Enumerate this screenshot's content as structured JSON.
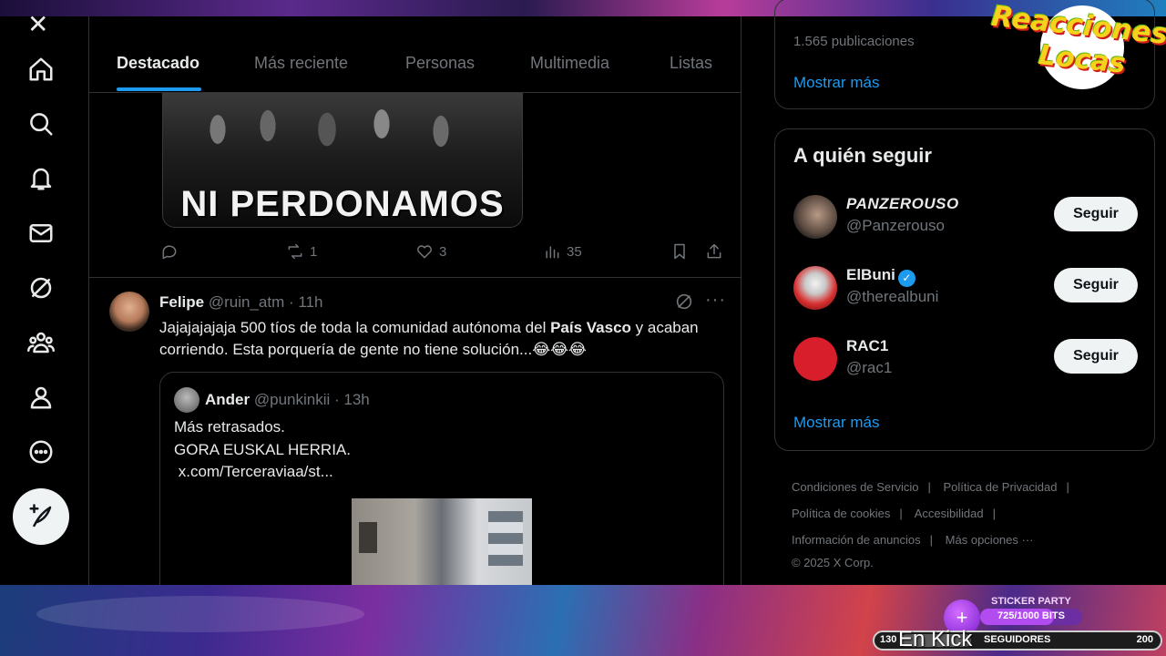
{
  "tabs": [
    "Destacado",
    "Más reciente",
    "Personas",
    "Multimedia",
    "Listas"
  ],
  "prev_post": {
    "media_caption": "NI PERDONAMOS",
    "retweets": "1",
    "likes": "3",
    "views": "35"
  },
  "tweet": {
    "name": "Felipe",
    "meta": "@ruin_atm · 11h",
    "text_before": "Jajajajajaja 500 tíos de toda la comunidad autónoma del ",
    "text_bold": "País Vasco",
    "text_after": " y acaban corriendo. Esta porquería de gente no tiene solución...😂😂😂",
    "more": "···",
    "quote": {
      "name": "Ander",
      "meta": "@punkinkii · 13h",
      "text": "Más retrasados.\nGORA EUSKAL HERRIA.\n x.com/Terceraviaa/st..."
    }
  },
  "sidebar": {
    "posts_count": "1.565 publicaciones",
    "show_more": "Mostrar más",
    "who_title": "A quién seguir",
    "follow_label": "Seguir",
    "accounts": [
      {
        "name": "PANZEROUSO",
        "handle": "@Panzerouso"
      },
      {
        "name": "ElBuni",
        "handle": "@therealbuni"
      },
      {
        "name": "RAC1",
        "handle": "@rac1"
      }
    ],
    "show_more_2": "Mostrar más",
    "footer": {
      "terms": "Condiciones de Servicio",
      "privacy": "Política de Privacidad",
      "cookies": "Política de cookies",
      "accessibility": "Accesibilidad",
      "ads": "Información de anuncios",
      "more": "Más opciones ···",
      "copyright": "© 2025 X Corp."
    }
  },
  "overlay": {
    "logo_line1": "Reacciones",
    "logo_line2": "Locas",
    "sticker_title": "STICKER PARTY",
    "sticker_progress": "725/1000 BITS",
    "sticker_fraction": 0.725,
    "followers_left": "130",
    "followers_label": "SEGUIDORES",
    "followers_right": "200",
    "followers_fraction": 0.3,
    "kick_text": "En Kick"
  },
  "colors": {
    "accent": "#1d9bf0",
    "bg": "#000000",
    "muted": "#71767b"
  }
}
